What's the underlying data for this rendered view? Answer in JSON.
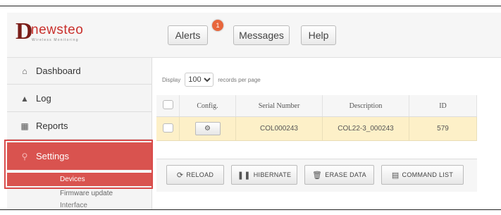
{
  "brand": {
    "logo_initial": "D",
    "logo_word": "newsteo",
    "tagline": "Wireless Monitoring"
  },
  "header": {
    "alerts_label": "Alerts",
    "alerts_badge": "1",
    "messages_label": "Messages",
    "help_label": "Help"
  },
  "sidebar": {
    "items": [
      {
        "label": "Dashboard",
        "icon": "home-icon"
      },
      {
        "label": "Log",
        "icon": "tree-icon"
      },
      {
        "label": "Reports",
        "icon": "briefcase-icon"
      },
      {
        "label": "Settings",
        "icon": "wrench-icon"
      }
    ],
    "subitems": [
      {
        "label": "Devices",
        "active": true
      },
      {
        "label": "Firmware update"
      },
      {
        "label": "Interface"
      }
    ]
  },
  "table_controls": {
    "display_prefix": "Display",
    "page_size": "100",
    "display_suffix": "records per page"
  },
  "table": {
    "columns": [
      "",
      "Config.",
      "Serial Number",
      "Description",
      "ID"
    ],
    "rows": [
      {
        "serial": "COL000243",
        "description": "COL22-3_000243",
        "id": "579",
        "config_icon": "gear-icon"
      }
    ]
  },
  "toolbar": {
    "reload": "RELOAD",
    "hibernate": "HIBERNATE",
    "erase": "ERASE DATA",
    "command_list": "COMMAND LIST"
  },
  "colors": {
    "accent": "#d9534f",
    "row_highlight": "#fdf0c8",
    "badge": "#e8663c"
  }
}
